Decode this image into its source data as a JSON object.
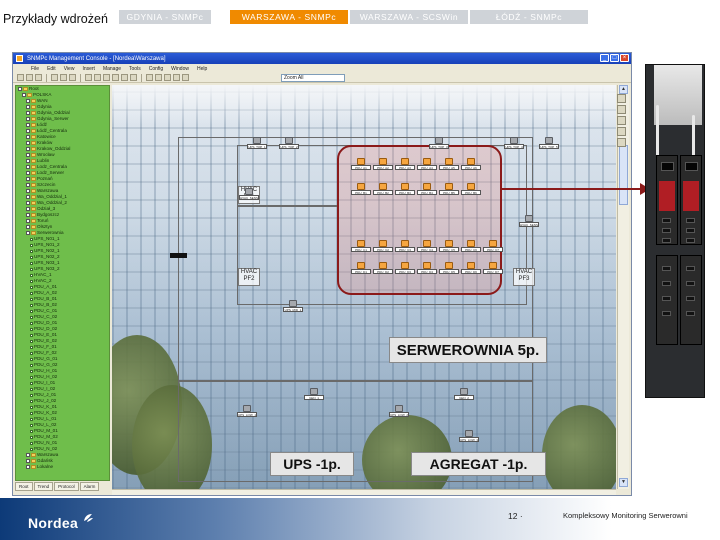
{
  "slide": {
    "title": "Przykłady wdrożeń",
    "tabs": [
      {
        "label": "GDYNIA - SNMPc",
        "active": false
      },
      {
        "label": "WARSZAWA - SNMPc",
        "active": true
      },
      {
        "label": "WARSZAWA - SCSWin",
        "active": false
      },
      {
        "label": "ŁÓDŹ - SNMPc",
        "active": false
      }
    ],
    "accent_color": "#f08a00",
    "inactive_tab_color": "#cfd3d8"
  },
  "window": {
    "title": "SNMPc Management Console - [Nordea\\Warszawa]",
    "menu": [
      "File",
      "Edit",
      "View",
      "Insert",
      "Manage",
      "Tools",
      "Config",
      "Window",
      "Help"
    ],
    "zoom_value": "Zoom All"
  },
  "tree": {
    "items": [
      {
        "label": "Root",
        "kind": "folder"
      },
      {
        "label": "POLSKA",
        "kind": "folder"
      },
      {
        "label": "WAN",
        "kind": "folder"
      },
      {
        "label": "Gdynia",
        "kind": "folder"
      },
      {
        "label": "Gdynia_Oddzial",
        "kind": "folder"
      },
      {
        "label": "Gdynia_Serwer",
        "kind": "folder"
      },
      {
        "label": "Łódź",
        "kind": "folder"
      },
      {
        "label": "Łódź_Centrala",
        "kind": "folder"
      },
      {
        "label": "Katowice",
        "kind": "folder"
      },
      {
        "label": "Kraków",
        "kind": "folder"
      },
      {
        "label": "Krakow_Oddzial",
        "kind": "folder"
      },
      {
        "label": "Wrocław",
        "kind": "folder"
      },
      {
        "label": "Lublin",
        "kind": "folder"
      },
      {
        "label": "Lodz_Centrala",
        "kind": "folder"
      },
      {
        "label": "Lodz_Serwer",
        "kind": "folder"
      },
      {
        "label": "Poznań",
        "kind": "folder"
      },
      {
        "label": "Szczecin",
        "kind": "folder"
      },
      {
        "label": "Warszawa",
        "kind": "folder"
      },
      {
        "label": "Wa_Oddzial_1",
        "kind": "folder"
      },
      {
        "label": "Wa_Oddzial_2",
        "kind": "folder"
      },
      {
        "label": "Odział_3",
        "kind": "folder"
      },
      {
        "label": "Bydgoszcz",
        "kind": "folder"
      },
      {
        "label": "Toruń",
        "kind": "folder"
      },
      {
        "label": "Olsztyn",
        "kind": "folder"
      },
      {
        "label": "Serwerownia",
        "kind": "folder"
      },
      {
        "label": "UPS_N01_1",
        "kind": "node"
      },
      {
        "label": "UPS_N01_2",
        "kind": "node"
      },
      {
        "label": "UPS_N02_1",
        "kind": "node"
      },
      {
        "label": "UPS_N02_2",
        "kind": "node"
      },
      {
        "label": "UPS_N03_1",
        "kind": "node"
      },
      {
        "label": "UPS_N03_2",
        "kind": "node"
      },
      {
        "label": "HVAC_1",
        "kind": "node"
      },
      {
        "label": "HVAC_2",
        "kind": "node"
      },
      {
        "label": "PDU_A_01",
        "kind": "node"
      },
      {
        "label": "PDU_A_02",
        "kind": "node"
      },
      {
        "label": "PDU_B_01",
        "kind": "node"
      },
      {
        "label": "PDU_B_02",
        "kind": "node"
      },
      {
        "label": "PDU_C_01",
        "kind": "node"
      },
      {
        "label": "PDU_C_02",
        "kind": "node"
      },
      {
        "label": "PDU_D_01",
        "kind": "node"
      },
      {
        "label": "PDU_D_02",
        "kind": "node"
      },
      {
        "label": "PDU_E_01",
        "kind": "node"
      },
      {
        "label": "PDU_E_02",
        "kind": "node"
      },
      {
        "label": "PDU_F_01",
        "kind": "node"
      },
      {
        "label": "PDU_F_02",
        "kind": "node"
      },
      {
        "label": "PDU_G_01",
        "kind": "node"
      },
      {
        "label": "PDU_G_02",
        "kind": "node"
      },
      {
        "label": "PDU_H_01",
        "kind": "node"
      },
      {
        "label": "PDU_H_02",
        "kind": "node"
      },
      {
        "label": "PDU_I_01",
        "kind": "node"
      },
      {
        "label": "PDU_I_02",
        "kind": "node"
      },
      {
        "label": "PDU_J_01",
        "kind": "node"
      },
      {
        "label": "PDU_J_02",
        "kind": "node"
      },
      {
        "label": "PDU_K_01",
        "kind": "node"
      },
      {
        "label": "PDU_K_02",
        "kind": "node"
      },
      {
        "label": "PDU_L_01",
        "kind": "node"
      },
      {
        "label": "PDU_L_02",
        "kind": "node"
      },
      {
        "label": "PDU_M_01",
        "kind": "node"
      },
      {
        "label": "PDU_M_02",
        "kind": "node"
      },
      {
        "label": "PDU_N_01",
        "kind": "node"
      },
      {
        "label": "PDU_N_02",
        "kind": "node"
      },
      {
        "label": "Warszawa",
        "kind": "folder"
      },
      {
        "label": "Gdańsk",
        "kind": "folder"
      },
      {
        "label": "Lokalne",
        "kind": "folder"
      }
    ],
    "tabs": [
      "Root",
      "Trend",
      "Protocol",
      "Alarm"
    ]
  },
  "plan": {
    "hvac_units": [
      "HVAC PF1",
      "HVAC PF2",
      "HVAC PF3"
    ],
    "server_devices": [
      "PDU_A1",
      "PDU_A2",
      "PDU_A3",
      "PDU_A4",
      "PDU_A5",
      "PDU_A6",
      "PDU_B1",
      "PDU_B2",
      "PDU_B3",
      "PDU_B4",
      "PDU_B5",
      "PDU_B6",
      "PDU_C1",
      "PDU_C2",
      "PDU_C3",
      "PDU_C4",
      "PDU_C5",
      "PDU_C6",
      "PDU_C7",
      "PDU_D1",
      "PDU_D2",
      "PDU_D3",
      "PDU_D4",
      "PDU_D5",
      "PDU_D6",
      "PDU_D7"
    ],
    "other_devices": [
      "UPS_TOP_1",
      "UPS_TOP_2",
      "UPS_TOP_3",
      "UPS_TOP_4",
      "UPS_TOP_5",
      "HVAC_SENS_1",
      "HVAC_SENS_2",
      "UPS_MID_1",
      "GEN_1",
      "GEN_2",
      "UPS_LOW_1",
      "UPS_LOW_2",
      "UPS_LOW_3"
    ],
    "labels": {
      "server_room": "SERWEROWNIA 5p.",
      "ups": "UPS -1p.",
      "agregat": "AGREGAT -1p."
    },
    "zone_color": "#8b1a1a"
  },
  "footer": {
    "logo": "Nordea",
    "page_number": "12 ·",
    "text": "Kompleksowy Monitoring Serwerowni"
  }
}
